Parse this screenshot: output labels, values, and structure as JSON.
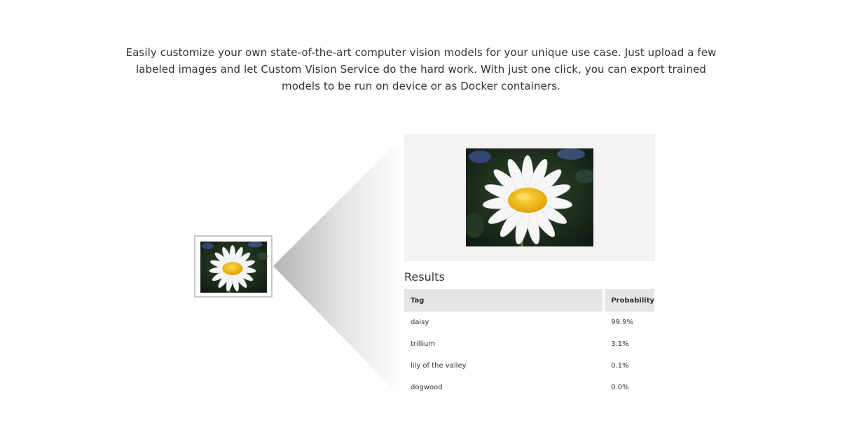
{
  "intro": {
    "text": "Easily customize your own state-of-the-art computer vision models for your unique use case. Just upload a few labeled images and let Custom Vision Service do the hard work. With just one click, you can export trained models to be run on device or as Docker containers."
  },
  "demo": {
    "thumbnail_icon": "daisy-photo",
    "preview_icon": "daisy-photo"
  },
  "results": {
    "title": "Results",
    "headers": {
      "tag": "Tag",
      "probability": "Probability"
    },
    "rows": [
      {
        "tag": "daisy",
        "probability": "99.9%"
      },
      {
        "tag": "trillium",
        "probability": "3.1%"
      },
      {
        "tag": "lily of the valley",
        "probability": "0.1%"
      },
      {
        "tag": "dogwood",
        "probability": "0.0%"
      }
    ]
  },
  "colors": {
    "panel_background": "#f3f3f3",
    "header_background": "#e5e5e5",
    "petal": "#ffffff",
    "flower_center": "#f2b705",
    "photo_background": "#1f3320"
  }
}
